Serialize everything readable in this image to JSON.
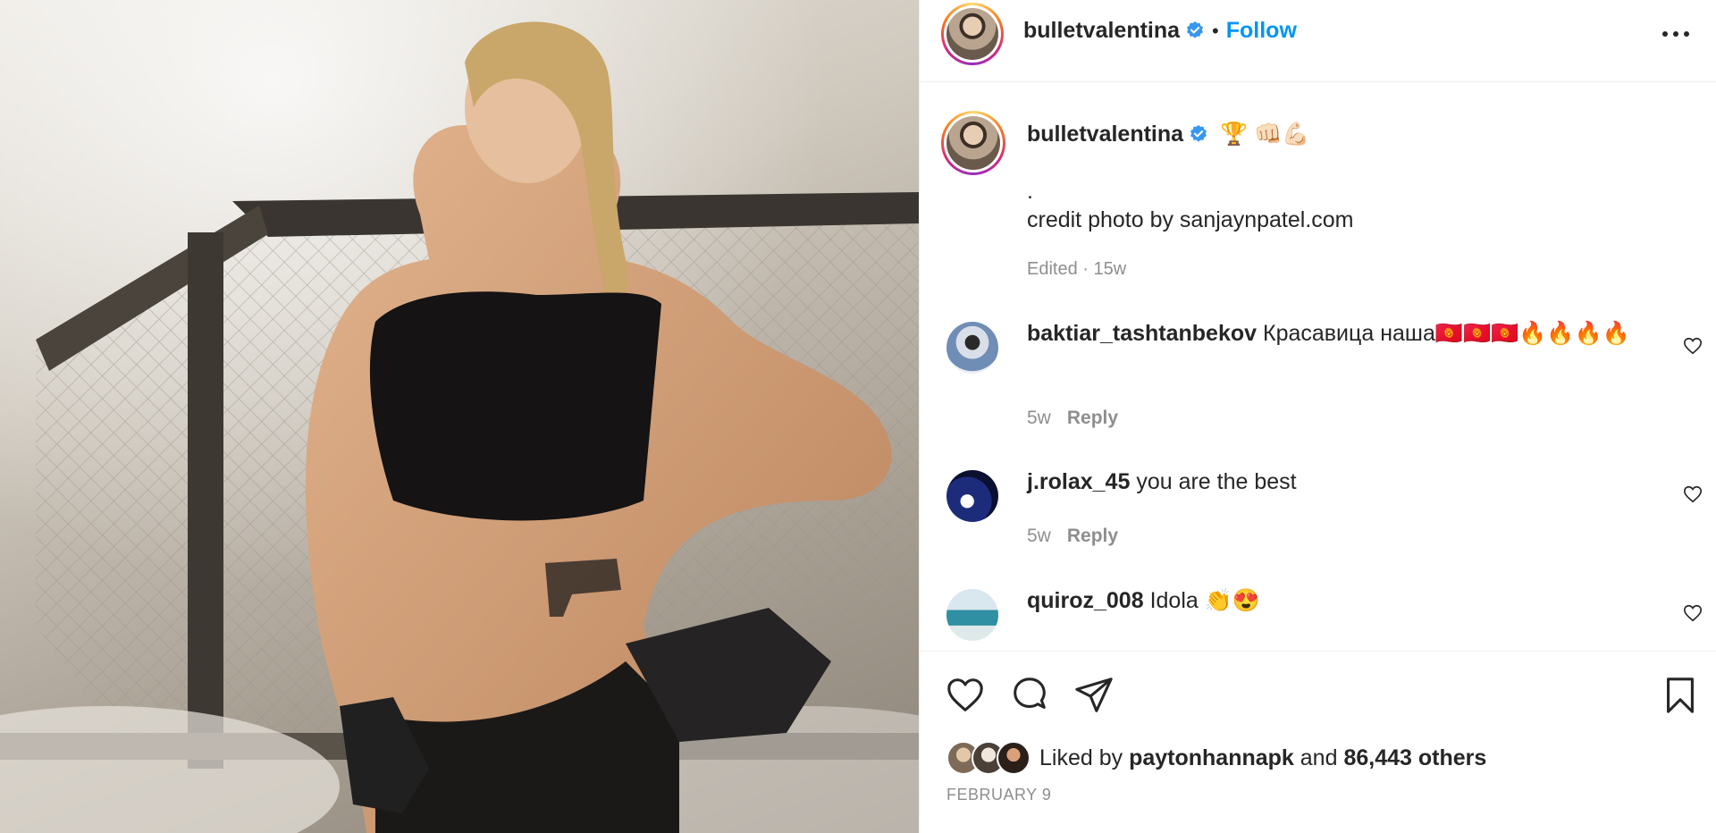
{
  "post": {
    "username": "bulletvalentina",
    "follow_label": "Follow",
    "separator": "•"
  },
  "caption": {
    "username": "bulletvalentina",
    "emoji": "🏆 👊🏻💪🏻",
    "line1": ".",
    "line2": "credit photo by sanjaynpatel.com",
    "meta": "Edited · 15w"
  },
  "comments": [
    {
      "username": "baktiar_tashtanbekov",
      "text": "Красавица наша🇰🇬🇰🇬🇰🇬🔥🔥🔥🔥",
      "time": "5w",
      "reply": "Reply"
    },
    {
      "username": "j.rolax_45",
      "text": "you are the best",
      "time": "5w",
      "reply": "Reply"
    },
    {
      "username": "quiroz_008",
      "text": "Idola 👏😍"
    }
  ],
  "likes": {
    "prefix": "Liked by",
    "user": "paytonhannapk",
    "middle": "and",
    "others": "86,443 others"
  },
  "date": "FEBRUARY 9",
  "colors": {
    "accent": "#0095f6",
    "verified": "#3897f0",
    "muted": "#8e8e8e"
  }
}
